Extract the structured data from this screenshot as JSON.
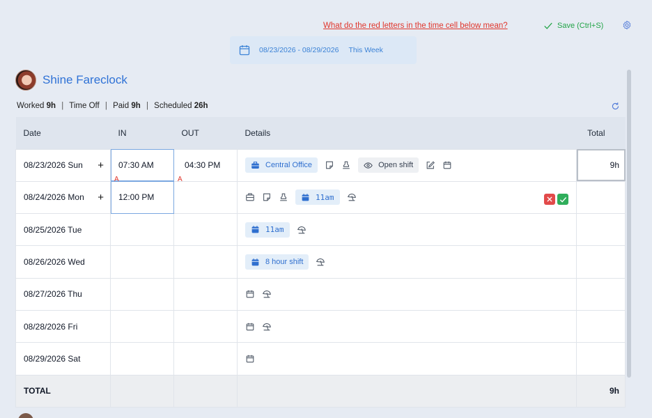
{
  "header": {
    "help_link": "What do the red letters in the time cell below mean?",
    "save_label": "Save (Ctrl+S)",
    "date_range": "08/23/2026 - 08/29/2026",
    "this_week": "This Week"
  },
  "user": {
    "name": "Shine Fareclock"
  },
  "summary": {
    "worked_label": "Worked",
    "worked_value": "9h",
    "time_off_label": "Time Off",
    "paid_label": "Paid",
    "paid_value": "9h",
    "scheduled_label": "Scheduled",
    "scheduled_value": "26h"
  },
  "table": {
    "headers": {
      "date": "Date",
      "in": "IN",
      "out": "OUT",
      "details": "Details",
      "total": "Total"
    },
    "rows": [
      {
        "date": "08/23/2026 Sun",
        "in": "07:30 AM",
        "out": "04:30 PM",
        "in_flag": "A",
        "out_flag": "A",
        "location": "Central Office",
        "open_shift": "Open shift",
        "total": "9h"
      },
      {
        "date": "08/24/2026 Mon",
        "in": "12:00 PM",
        "out": "",
        "schedule": "11am",
        "total": ""
      },
      {
        "date": "08/25/2026 Tue",
        "in": "",
        "out": "",
        "schedule": "11am",
        "total": ""
      },
      {
        "date": "08/26/2026 Wed",
        "in": "",
        "out": "",
        "schedule": "8 hour shift",
        "total": ""
      },
      {
        "date": "08/27/2026 Thu",
        "in": "",
        "out": "",
        "total": ""
      },
      {
        "date": "08/28/2026 Fri",
        "in": "",
        "out": "",
        "total": ""
      },
      {
        "date": "08/29/2026 Sat",
        "in": "",
        "out": "",
        "total": ""
      }
    ],
    "total_row": {
      "label": "TOTAL",
      "total": "9h"
    }
  },
  "add_symbol": "+",
  "colors": {
    "accent": "#2f6fcf",
    "save_green": "#22a447",
    "warning_red": "#e0362c"
  }
}
